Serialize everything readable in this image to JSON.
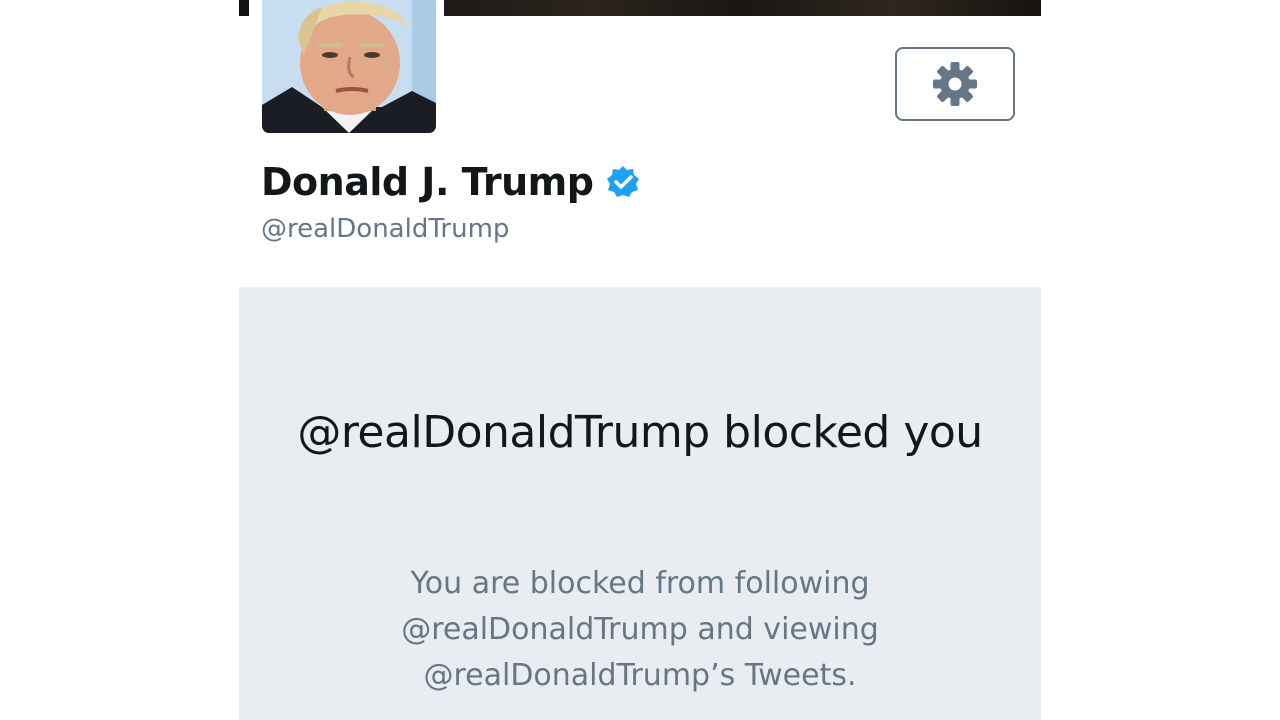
{
  "profile": {
    "display_name": "Donald J. Trump",
    "handle": "@realDonaldTrump",
    "verified": true
  },
  "icons": {
    "settings": "gear-icon",
    "verified": "verified-badge-icon",
    "avatar": "profile-photo"
  },
  "blocked": {
    "title": "@realDonaldTrump blocked you",
    "description": "You are blocked from following @realDonaldTrump and viewing @realDonaldTrump’s Tweets."
  },
  "colors": {
    "verified_blue": "#1da1f2",
    "secondary_text": "#657786",
    "panel_bg": "#e9edf1"
  }
}
